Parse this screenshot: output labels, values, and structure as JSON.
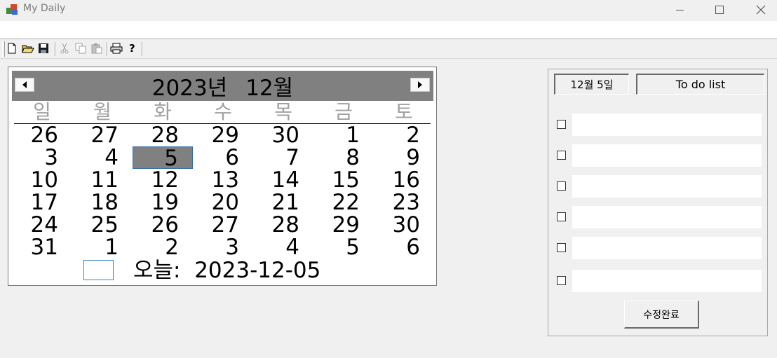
{
  "window": {
    "title": "My Daily",
    "app_icon": "app-icon",
    "controls": [
      "minimize-icon",
      "maximize-icon",
      "close-icon"
    ]
  },
  "toolbar": {
    "buttons": [
      {
        "icon": "new-file-icon",
        "glyph": "🗋"
      },
      {
        "icon": "open-folder-icon",
        "glyph": "📂"
      },
      {
        "icon": "save-icon",
        "glyph": "💾"
      },
      {
        "icon": "cut-icon",
        "glyph": "✂"
      },
      {
        "icon": "copy-icon",
        "glyph": "⎘"
      },
      {
        "icon": "paste-icon",
        "glyph": "📋"
      },
      {
        "icon": "print-icon",
        "glyph": "🖶"
      },
      {
        "icon": "help-icon",
        "glyph": "?"
      }
    ]
  },
  "calendar": {
    "year_label": "2023년",
    "month_label": "12월",
    "weekdays": [
      "일",
      "월",
      "화",
      "수",
      "목",
      "금",
      "토"
    ],
    "weeks": [
      [
        "26",
        "27",
        "28",
        "29",
        "30",
        "1",
        "2"
      ],
      [
        "3",
        "4",
        "5",
        "6",
        "7",
        "8",
        "9"
      ],
      [
        "10",
        "11",
        "12",
        "13",
        "14",
        "15",
        "16"
      ],
      [
        "17",
        "18",
        "19",
        "20",
        "21",
        "22",
        "23"
      ],
      [
        "24",
        "25",
        "26",
        "27",
        "28",
        "29",
        "30"
      ],
      [
        "31",
        "1",
        "2",
        "3",
        "4",
        "5",
        "6"
      ]
    ],
    "selected_day": "5",
    "today_label": "오늘:  2023-12-05",
    "colors": {
      "header_bg": "#808080",
      "weekday_text": "#a0a0a0",
      "selected_bg": "#808080"
    }
  },
  "todo": {
    "date_tab": "12월 5일",
    "list_tab": "To do list",
    "items": [
      {
        "checked": false,
        "text": ""
      },
      {
        "checked": false,
        "text": ""
      },
      {
        "checked": false,
        "text": ""
      },
      {
        "checked": false,
        "text": ""
      },
      {
        "checked": false,
        "text": ""
      },
      {
        "checked": false,
        "text": ""
      }
    ],
    "save_label": "수정완료"
  }
}
